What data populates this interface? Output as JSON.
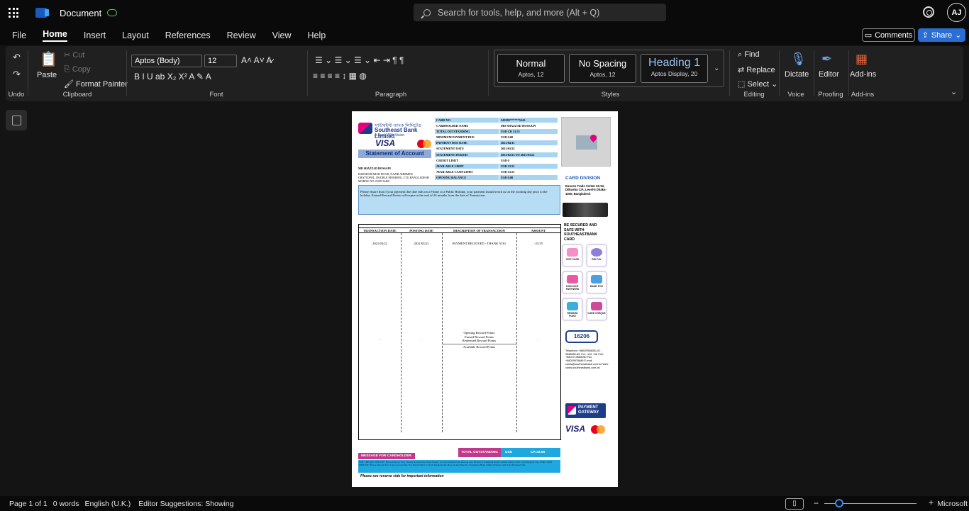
{
  "app": {
    "title": "Document",
    "search_placeholder": "Search for tools, help, and more (Alt + Q)",
    "user_initials": "AJ"
  },
  "menu": [
    "File",
    "Home",
    "Insert",
    "Layout",
    "References",
    "Review",
    "View",
    "Help"
  ],
  "actions": {
    "comments": "Comments",
    "share": "Share"
  },
  "ribbon": {
    "undo_label": "Undo",
    "clipboard": {
      "paste": "Paste",
      "cut": "Cut",
      "copy": "Copy",
      "format_painter": "Format Painter",
      "label": "Clipboard"
    },
    "font": {
      "family": "Aptos (Body)",
      "size": "12",
      "label": "Font"
    },
    "paragraph": {
      "label": "Paragraph"
    },
    "styles": {
      "label": "Styles",
      "items": [
        {
          "name": "Normal",
          "sub": "Aptos, 12"
        },
        {
          "name": "No Spacing",
          "sub": "Aptos, 12"
        },
        {
          "name": "Heading 1",
          "sub": "Aptos Display, 20"
        }
      ]
    },
    "editing": {
      "find": "Find",
      "replace": "Replace",
      "select": "Select",
      "label": "Editing"
    },
    "voice": {
      "dictate": "Dictate",
      "label": "Voice"
    },
    "proofing": {
      "editor": "Editor",
      "label": "Proofing"
    },
    "addins": {
      "addins": "Add-ins",
      "label": "Add-ins"
    }
  },
  "statement": {
    "bank_bn": "সাউথইস্ট ব্যাংক লিমিটেড",
    "bank_en": "Southeast Bank Limited",
    "tagline": "A Bank With Vision",
    "visa": "VISA",
    "title": "Statement of Account",
    "holder_name": "MD SHAZZAD HOSSAIN",
    "address": "BADSHAH MIAH ROAD, NAZIR AHMMED, CHATTOPOL, DOUBLE MOORING, CTG BANGLADESH MOBILE NO. 0185514460",
    "fields": [
      {
        "k": "CARD NO",
        "v": "543985******5245"
      },
      {
        "k": "CARDHOLDER NAME",
        "v": "MD SHAZZAD HOSSAIN"
      },
      {
        "k": "TOTAL OUTSTANDING",
        "v": "USD CR 23.55"
      },
      {
        "k": "MINIMUM PAYMENT DUE",
        "v": "USD 0.00"
      },
      {
        "k": "PAYMENT DUE DATE",
        "v": "2021/04/11"
      },
      {
        "k": "STATEMENT DATE",
        "v": "2021/03/22"
      },
      {
        "k": "STATEMENT PERIOD",
        "v": "2021/02/23 TO 2021/03/22"
      },
      {
        "k": "CREDIT LIMIT",
        "v": "USD 0"
      },
      {
        "k": "AVAILABLE LIMIT",
        "v": "USD 23.55"
      },
      {
        "k": "AVAILABLE CASH LIMIT",
        "v": "USD 23.55"
      },
      {
        "k": "OPENING BALANCE",
        "v": "USD 0.00"
      }
    ],
    "note": "Please ensure that if your payment due date falls on a Friday or a Public Holiday, your payment should reach us on the working day prior to the holiday. Earned Reward Points will expire at the end of 24 months from the date of Transaction.",
    "table_headers": [
      "TRANSACTION DATE",
      "POSTING DATE",
      "DESCRIPTION OF TRANSACTION",
      "AMOUNT"
    ],
    "txn": {
      "tdate": "2021/03/22",
      "pdate": "2021/03/22",
      "desc": "PAYMENT RECEIVED - THANK YOU",
      "amount": "-23.55"
    },
    "rewards": [
      "Opening Reward Points",
      "Earned Reward Points",
      "Redeemed Reward Points",
      "Available Reward Points"
    ],
    "dash": "-",
    "card_division": "CARD DIVISION",
    "division_address": "Eunoos Trade Center 52-53, Dilkusha C/A, Level-5 Dhaka-1000, Bangladesh",
    "secure_text": "BE SECURED AND SAFE WITH SOUTHEASTBANK CARD",
    "features": [
      "CHIP CARD",
      "EMI PAY",
      "DISCOUNT PARTNERS",
      "BANK POS",
      "REWARD POINT",
      "CARD CHEQUE"
    ],
    "hotline": "16206",
    "contacts": "Telephone +88029588061-67, 9588080-89, Ext.: 110, 116 Cell: +8801713668050 Fax: +88029576688 E-mail: cards@southeastbank.com.bd Web: cards.southeastbank.com.bd",
    "payment_gateway": "PAYMENT GATEWAY",
    "msg_title": "MESSAGE FOR CARDHOLDER",
    "total_label": "TOTAL OUTSTANDING",
    "total_currency": "USD",
    "total_value": "CR 23.55",
    "msg_body": "FOR CHEQUE DEPOSIT: Please Deposit Your Cheque At least One Week Earlier To Your Payment Due Date At Any Branch of Southeast Bank Limited Using Credit Card Payment Slip. FOR CASH DEPOSIT: Please Deposit Your Cash At least One/Two Days Earlier To Your Payment Due Date At Any Branch of Southeast Bank Limited Using Credit Card Payment Slip.",
    "reverse": "Please see reverse side for important information"
  },
  "status": {
    "page": "Page 1 of 1",
    "words": "0 words",
    "lang": "English (U.K.)",
    "editor": "Editor Suggestions: Showing",
    "brand": "Microsoft"
  }
}
